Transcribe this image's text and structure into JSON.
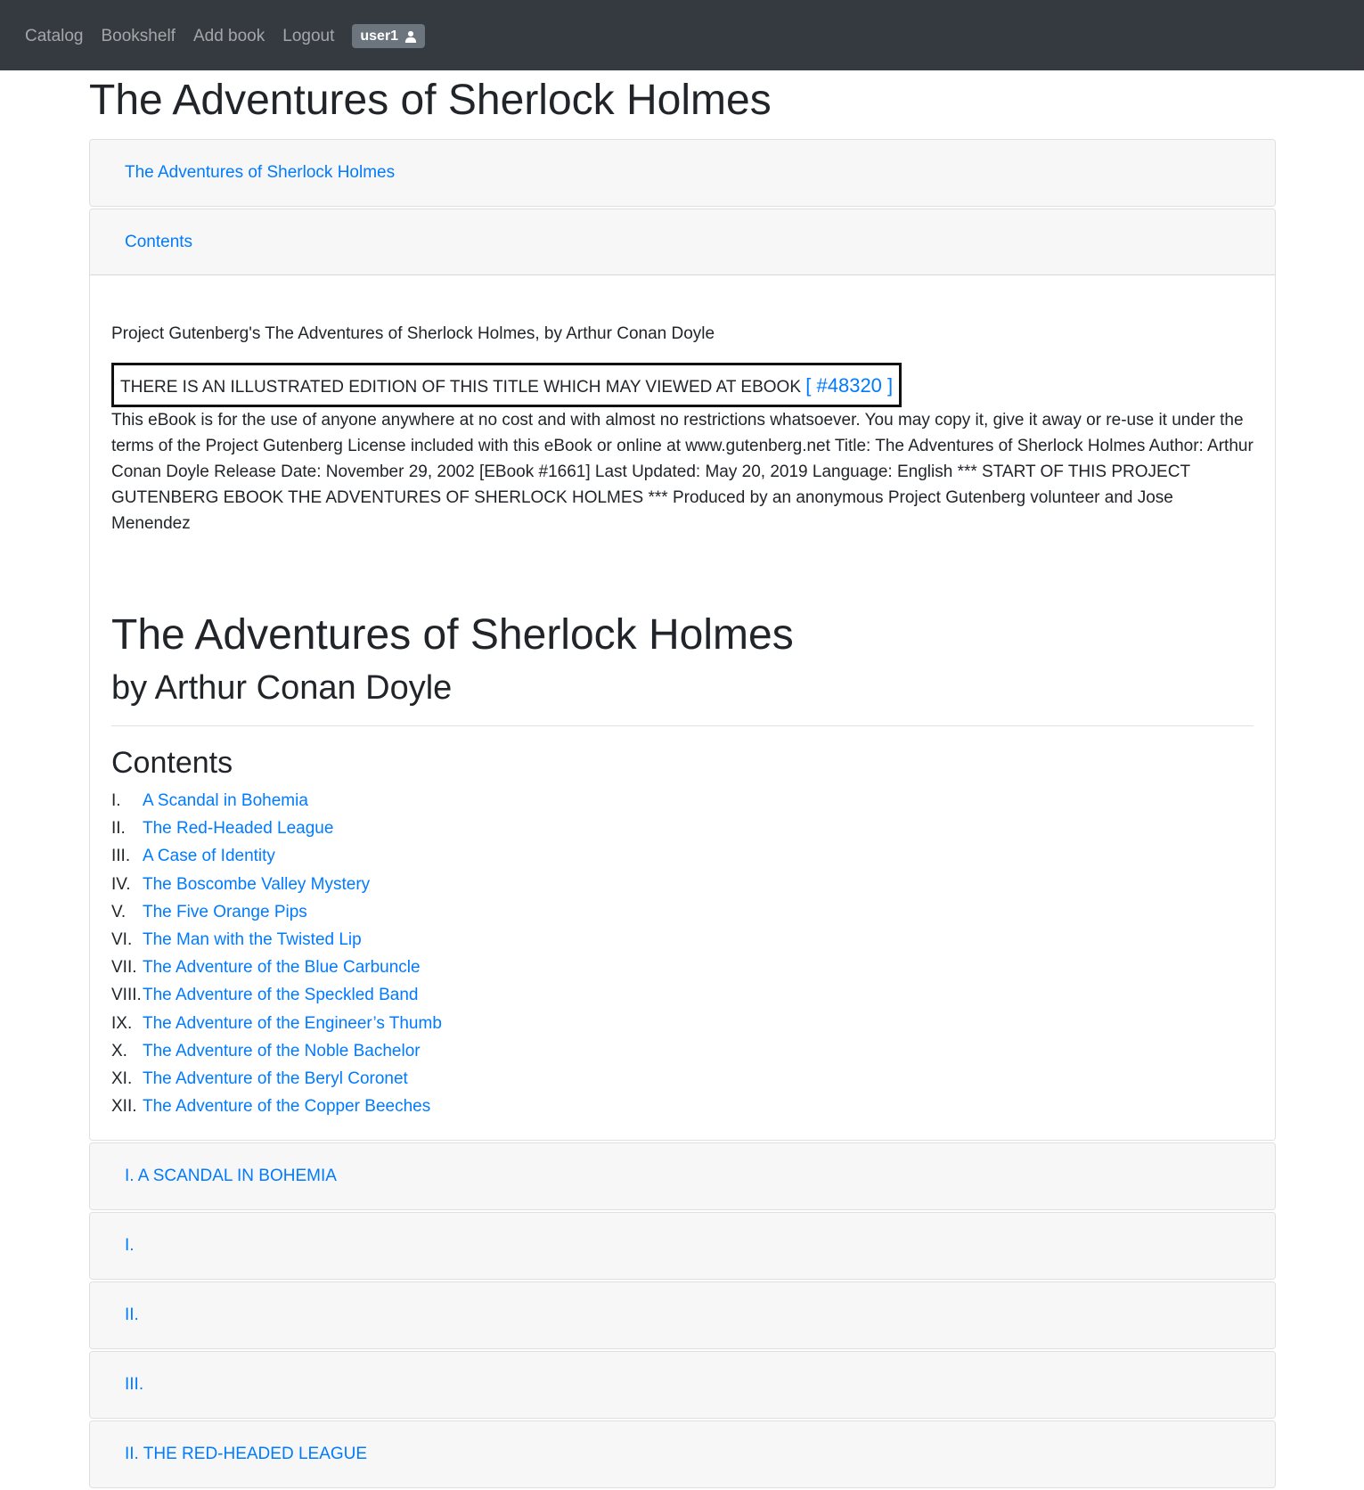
{
  "nav": {
    "links": [
      "Catalog",
      "Bookshelf",
      "Add book",
      "Logout"
    ],
    "user": "user1",
    "user_icon": "user-icon"
  },
  "page_title": "The Adventures of Sherlock Holmes",
  "accordion": {
    "section_title": "The Adventures of Sherlock Holmes",
    "contents_header": "Contents",
    "intro": "Project Gutenberg's The Adventures of Sherlock Holmes, by Arthur Conan Doyle",
    "notice": {
      "text": "THERE IS AN ILLUSTRATED EDITION OF THIS TITLE WHICH MAY VIEWED AT EBOOK",
      "link": "[ #48320 ]"
    },
    "license": "This eBook is for the use of anyone anywhere at no cost and with almost no restrictions whatsoever. You may copy it, give it away or re-use it under the terms of the Project Gutenberg License included with this eBook or online at www.gutenberg.net Title: The Adventures of Sherlock Holmes Author: Arthur Conan Doyle Release Date: November 29, 2002 [EBook #1661] Last Updated: May 20, 2019 Language: English *** START OF THIS PROJECT GUTENBERG EBOOK THE ADVENTURES OF SHERLOCK HOLMES *** Produced by an anonymous Project Gutenberg volunteer and Jose Menendez",
    "book_title": "The Adventures of Sherlock Holmes",
    "book_author": "by Arthur Conan Doyle",
    "contents_heading": "Contents",
    "toc": [
      {
        "num": "I.",
        "title": "A Scandal in Bohemia"
      },
      {
        "num": "II.",
        "title": "The Red-Headed League"
      },
      {
        "num": "III.",
        "title": "A Case of Identity"
      },
      {
        "num": "IV.",
        "title": "The Boscombe Valley Mystery"
      },
      {
        "num": "V.",
        "title": "The Five Orange Pips"
      },
      {
        "num": "VI.",
        "title": "The Man with the Twisted Lip"
      },
      {
        "num": "VII.",
        "title": "The Adventure of the Blue Carbuncle"
      },
      {
        "num": "VIII.",
        "title": "The Adventure of the Speckled Band"
      },
      {
        "num": "IX.",
        "title": "The Adventure of the Engineer’s Thumb"
      },
      {
        "num": "X.",
        "title": "The Adventure of the Noble Bachelor"
      },
      {
        "num": "XI.",
        "title": "The Adventure of the Beryl Coronet"
      },
      {
        "num": "XII.",
        "title": "The Adventure of the Copper Beeches"
      }
    ],
    "sections": [
      "I. A SCANDAL IN BOHEMIA",
      "I.",
      "II.",
      "III.",
      "II. THE RED-HEADED LEAGUE"
    ]
  },
  "colors": {
    "navbar_bg": "#343a40",
    "link": "#007bff",
    "badge_bg": "#6c757d",
    "card_header_bg": "#f7f7f7"
  }
}
